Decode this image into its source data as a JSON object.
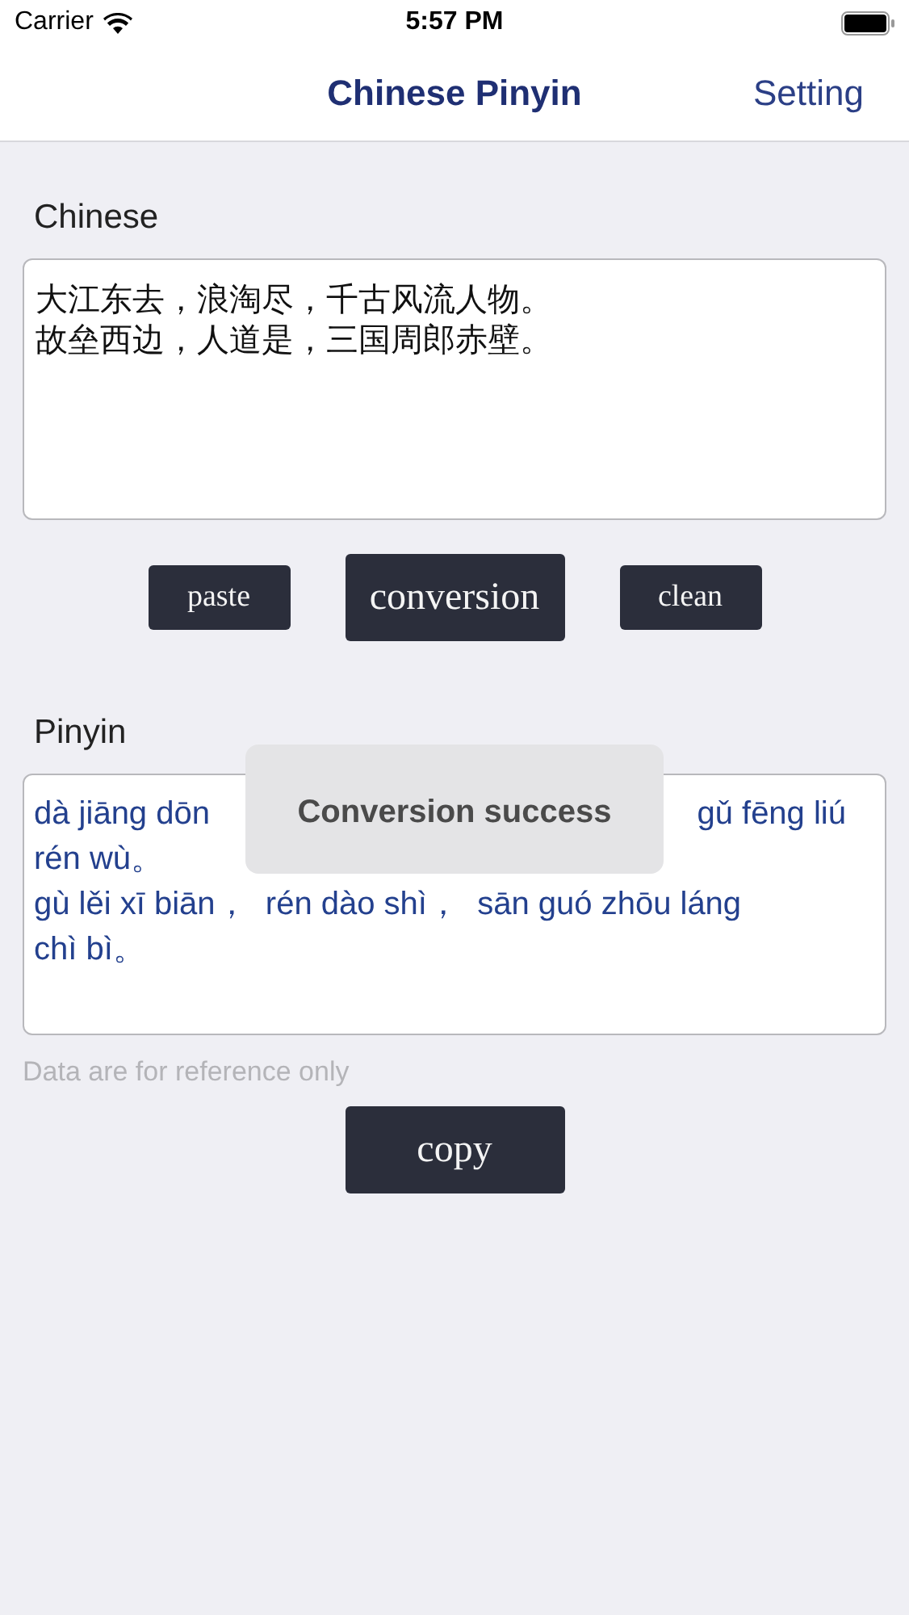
{
  "status_bar": {
    "carrier": "Carrier",
    "time": "5:57 PM"
  },
  "nav": {
    "title": "Chinese Pinyin",
    "action": "Setting"
  },
  "chinese": {
    "label": "Chinese",
    "lines": [
      "大江东去，浪淘尽，千古风流人物。",
      "故垒西边，人道是，三国周郎赤壁。"
    ]
  },
  "buttons": [
    {
      "label": "paste",
      "primary": false
    },
    {
      "label": "conversion",
      "primary": true
    },
    {
      "label": "clean",
      "primary": false
    }
  ],
  "pinyin": {
    "label": "Pinyin",
    "first_line": [
      "dà jiāng dōn",
      "gǔ fēng liú"
    ],
    "lines": [
      "rén wù。",
      "gù lěi xī biān，  rén dào shì，  sān guó zhōu láng",
      "chì bì。"
    ]
  },
  "toast": "Conversion success",
  "note": "Data are for reference only",
  "copy_button": "copy"
}
